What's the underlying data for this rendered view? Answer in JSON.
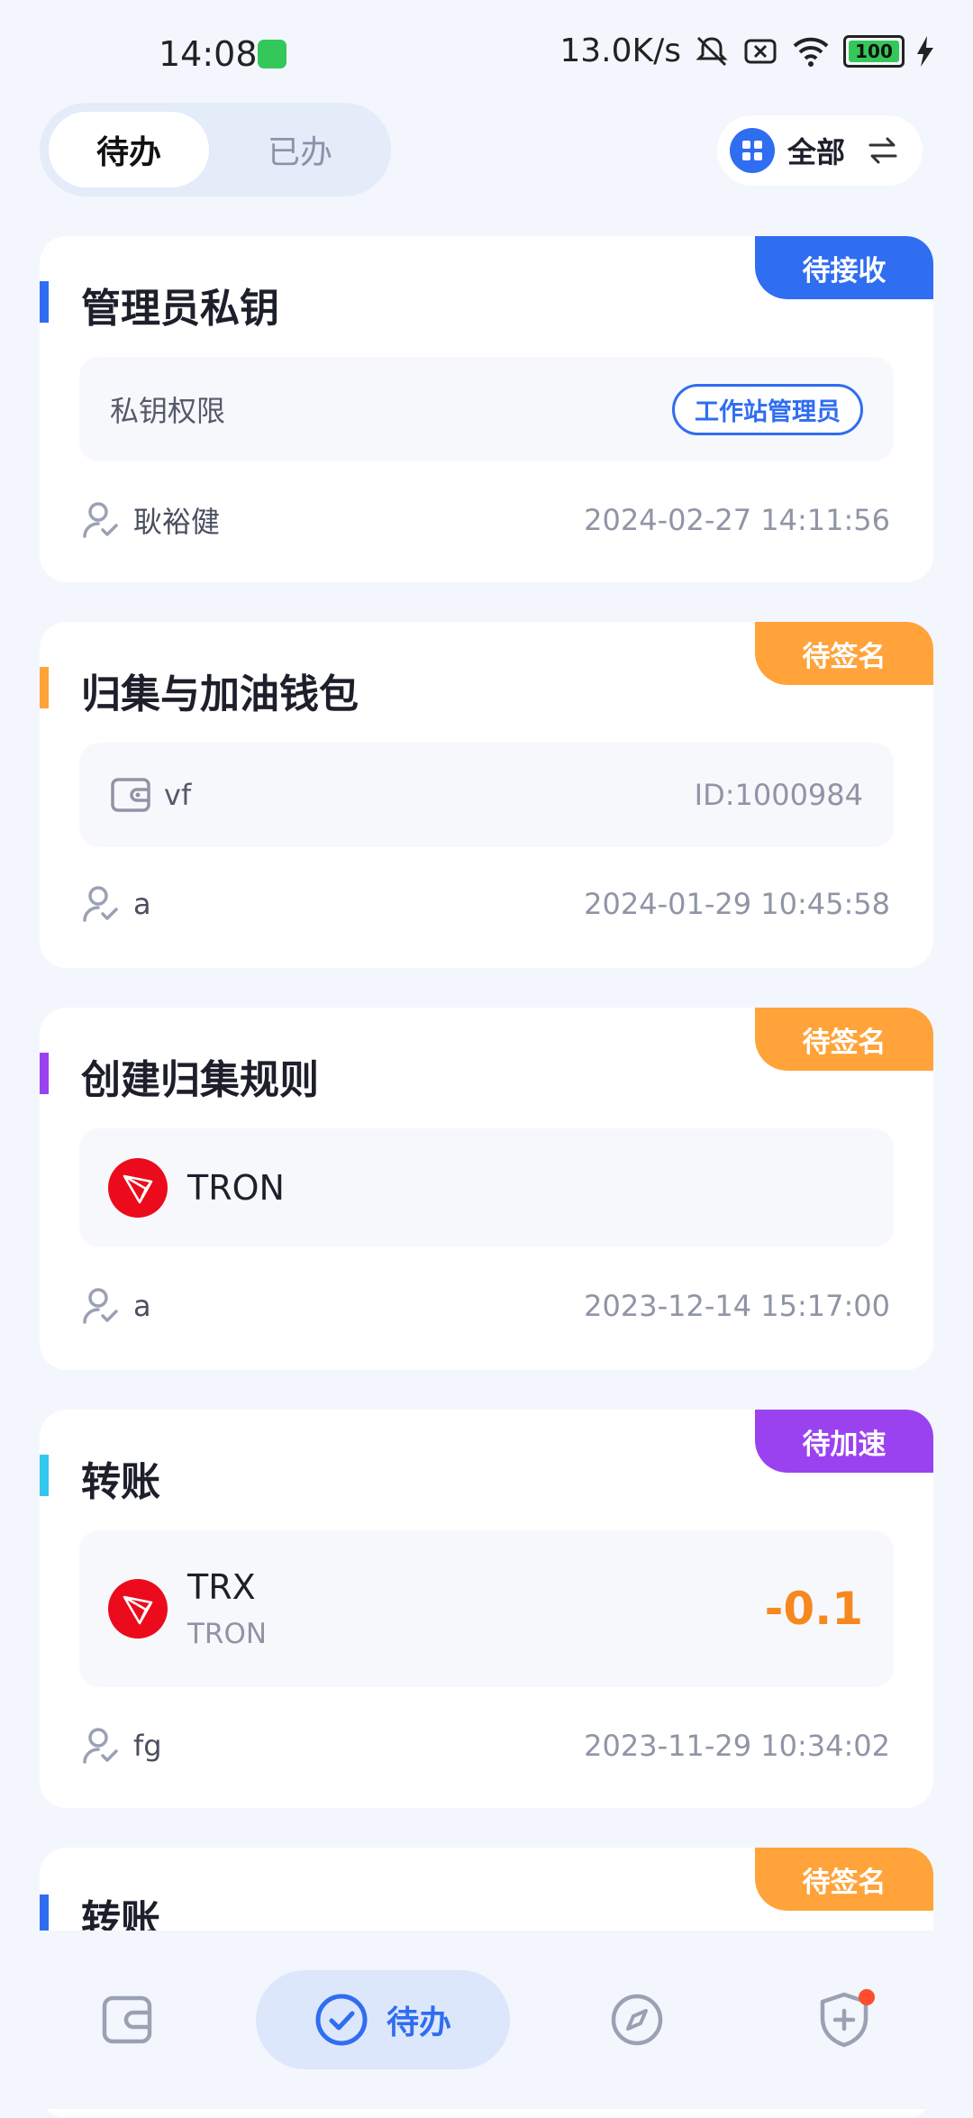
{
  "status_bar": {
    "time": "14:08",
    "speed": "13.0K/s",
    "battery": "100"
  },
  "tabs": {
    "todo": "待办",
    "done": "已办",
    "active": "todo"
  },
  "filter": {
    "label": "全部"
  },
  "cards": [
    {
      "title": "管理员私钥",
      "badge": "待接收",
      "badge_color": "#2f6df1",
      "accent_color": "#2f6df1",
      "detail_label": "私钥权限",
      "role_tag": "工作站管理员",
      "user": "耿裕健",
      "time": "2024-02-27 14:11:56"
    },
    {
      "title": "归集与加油钱包",
      "badge": "待签名",
      "badge_color": "#ffa33a",
      "accent_color": "#ffa33a",
      "wallet_name": "vf",
      "wallet_id": "ID:1000984",
      "user": "a",
      "time": "2024-01-29 10:45:58"
    },
    {
      "title": "创建归集规则",
      "badge": "待签名",
      "badge_color": "#ffa33a",
      "accent_color": "#9b42f0",
      "chain": "TRON",
      "user": "a",
      "time": "2023-12-14 15:17:00"
    },
    {
      "title": "转账",
      "badge": "待加速",
      "badge_color": "#9b42f0",
      "accent_color": "#33c7f0",
      "token": "TRX",
      "network": "TRON",
      "amount": "-0.1",
      "amount_color": "#f5891f",
      "user": "fg",
      "time": "2023-11-29 10:34:02"
    },
    {
      "title": "转账",
      "badge": "待签名",
      "badge_color": "#ffa33a",
      "accent_color": "#2f6df1"
    }
  ],
  "bottom_nav": {
    "active_label": "待办",
    "items": [
      "wallet-icon",
      "todo-check-icon",
      "compass-icon",
      "shield-plus-icon"
    ],
    "notification_dot_color": "#ff4d2d"
  }
}
